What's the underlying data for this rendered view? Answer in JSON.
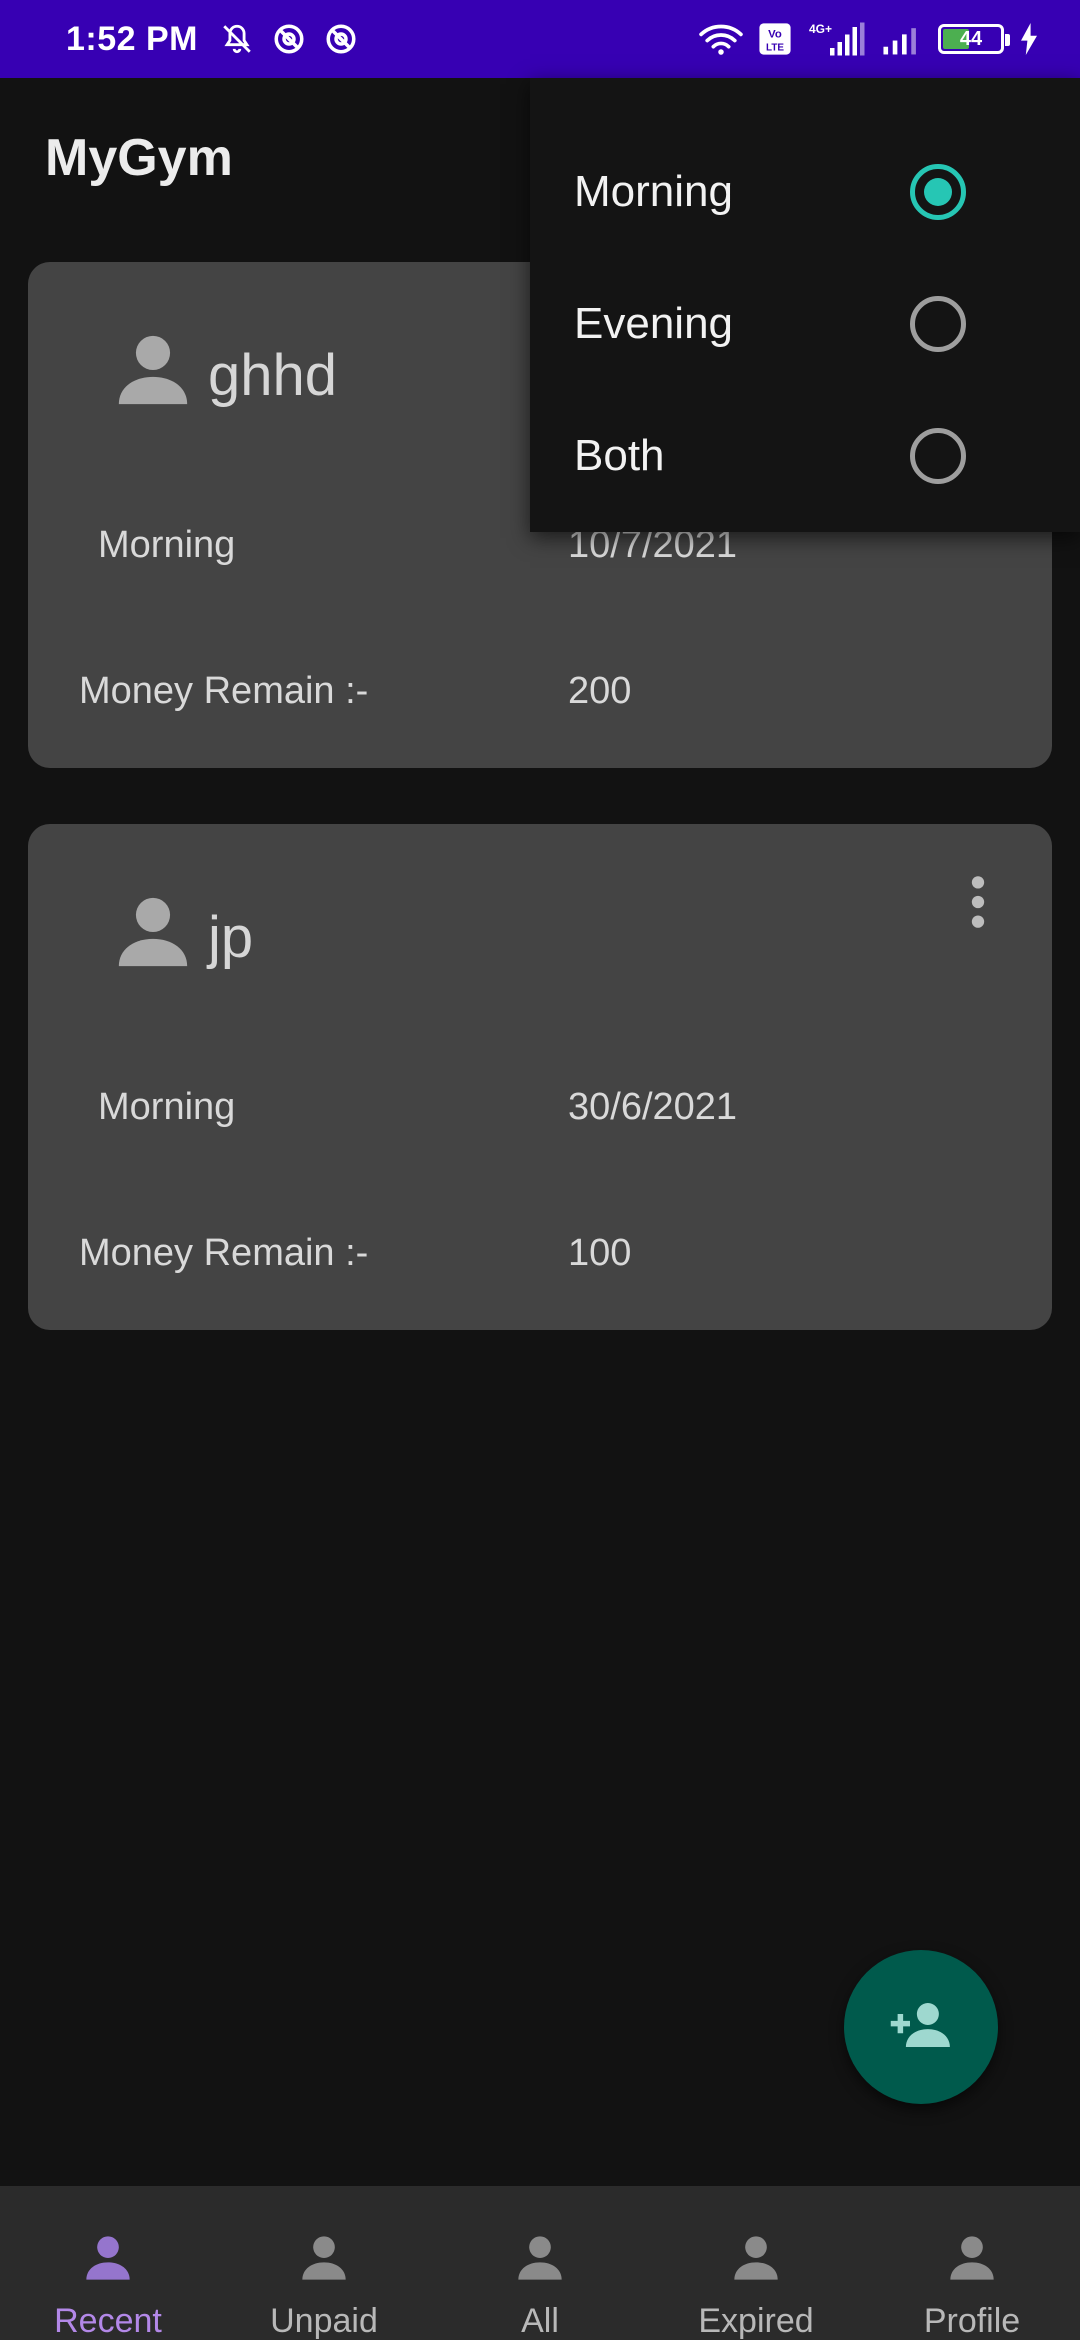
{
  "status_bar": {
    "time": "1:52 PM",
    "battery_level": "44",
    "icons": [
      "mute-icon",
      "do-not-disturb-icon",
      "do-not-disturb-icon",
      "wifi-icon",
      "volte-icon",
      "signal-4g-icon",
      "signal-icon",
      "battery-icon",
      "charging-icon"
    ]
  },
  "app_bar": {
    "title": "MyGym"
  },
  "members": [
    {
      "name": "ghhd",
      "shift": "Morning",
      "date": "10/7/2021",
      "money_label": "Money Remain :-",
      "money": "200"
    },
    {
      "name": "jp",
      "shift": "Morning",
      "date": "30/6/2021",
      "money_label": "Money Remain :-",
      "money": "100"
    }
  ],
  "shift_menu": {
    "options": [
      {
        "label": "Morning",
        "selected": true
      },
      {
        "label": "Evening",
        "selected": false
      },
      {
        "label": "Both",
        "selected": false
      }
    ]
  },
  "fab": {
    "icon": "add-person-icon"
  },
  "bottom_nav": {
    "active": "Recent",
    "items": [
      {
        "label": "Recent",
        "icon": "person-icon"
      },
      {
        "label": "Unpaid",
        "icon": "person-icon"
      },
      {
        "label": "All",
        "icon": "person-icon"
      },
      {
        "label": "Expired",
        "icon": "person-icon"
      },
      {
        "label": "Profile",
        "icon": "person-icon"
      }
    ]
  },
  "colors": {
    "status_bar": "#3700b3",
    "background": "#121212",
    "card": "#444444",
    "accent_teal": "#26c6b4",
    "fab": "#005a4c",
    "nav_active": "#b388e8"
  }
}
